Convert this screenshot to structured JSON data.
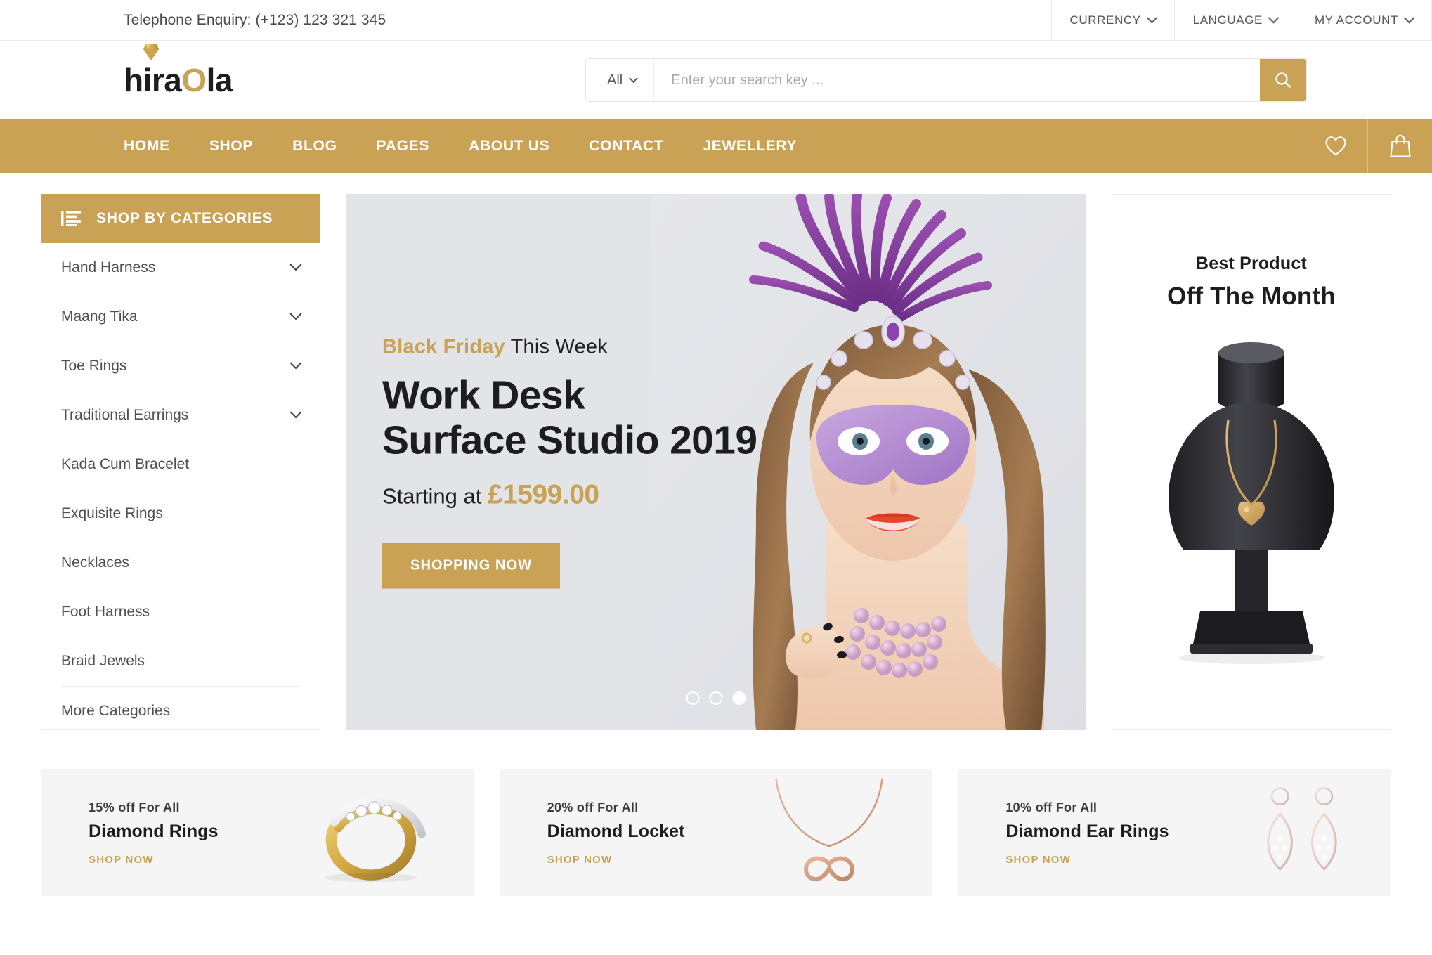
{
  "topbar": {
    "phone": "Telephone Enquiry: (+123) 123 321 345",
    "items": [
      {
        "label": "CURRENCY",
        "icon": "chevron-down-icon"
      },
      {
        "label": "LANGUAGE",
        "icon": "chevron-down-icon"
      },
      {
        "label": "MY ACCOUNT",
        "icon": "chevron-down-icon"
      }
    ]
  },
  "brand": {
    "name_part1": "hir",
    "name_part2": "a",
    "name_accent": "O",
    "name_part3": "la",
    "full": "hiraOla",
    "gem_icon": "diamond-icon",
    "accent_color": "#c9a255"
  },
  "search": {
    "category_label": "All",
    "placeholder": "Enter your search key ...",
    "value": "",
    "button_icon": "search-icon"
  },
  "mainnav": {
    "items": [
      {
        "label": "HOME"
      },
      {
        "label": "SHOP"
      },
      {
        "label": "BLOG"
      },
      {
        "label": "PAGES"
      },
      {
        "label": "ABOUT US"
      },
      {
        "label": "CONTACT"
      },
      {
        "label": "JEWELLERY"
      }
    ],
    "icons": [
      {
        "name": "wishlist-heart-icon"
      },
      {
        "name": "shopping-bag-icon"
      }
    ],
    "bar_color": "#c9a255"
  },
  "sidebar": {
    "header_label": "SHOP BY CATEGORIES",
    "header_icon": "category-list-icon",
    "items": [
      {
        "label": "Hand Harness",
        "has_chevron": true
      },
      {
        "label": "Maang Tika",
        "has_chevron": true
      },
      {
        "label": "Toe Rings",
        "has_chevron": true
      },
      {
        "label": "Traditional Earrings",
        "has_chevron": true
      },
      {
        "label": "Kada Cum Bracelet",
        "has_chevron": false
      },
      {
        "label": "Exquisite Rings",
        "has_chevron": false
      },
      {
        "label": "Necklaces",
        "has_chevron": false
      },
      {
        "label": "Foot Harness",
        "has_chevron": false
      },
      {
        "label": "Braid Jewels",
        "has_chevron": false
      }
    ],
    "more_label": "More Categories"
  },
  "hero": {
    "kicker_gold": "Black Friday",
    "kicker_rest": " This Week",
    "title_line1": "Work Desk",
    "title_line2": "Surface Studio 2019",
    "price_prefix": "Starting at ",
    "price_amount": "£1599.00",
    "cta_label": "SHOPPING NOW",
    "dots": [
      {
        "active": false
      },
      {
        "active": false
      },
      {
        "active": true
      }
    ]
  },
  "best_product": {
    "subtitle": "Best Product",
    "title": "Off The Month",
    "art": "necklace-display-bust"
  },
  "promos": [
    {
      "off": "15% off For All",
      "name": "Diamond Rings",
      "link": "SHOP NOW",
      "art": "diamond-ring-icon"
    },
    {
      "off": "20% off For All",
      "name": "Diamond Locket",
      "link": "SHOP NOW",
      "art": "infinity-necklace-icon"
    },
    {
      "off": "10% off For All",
      "name": "Diamond Ear Rings",
      "link": "SHOP NOW",
      "art": "diamond-earrings-icon"
    }
  ]
}
